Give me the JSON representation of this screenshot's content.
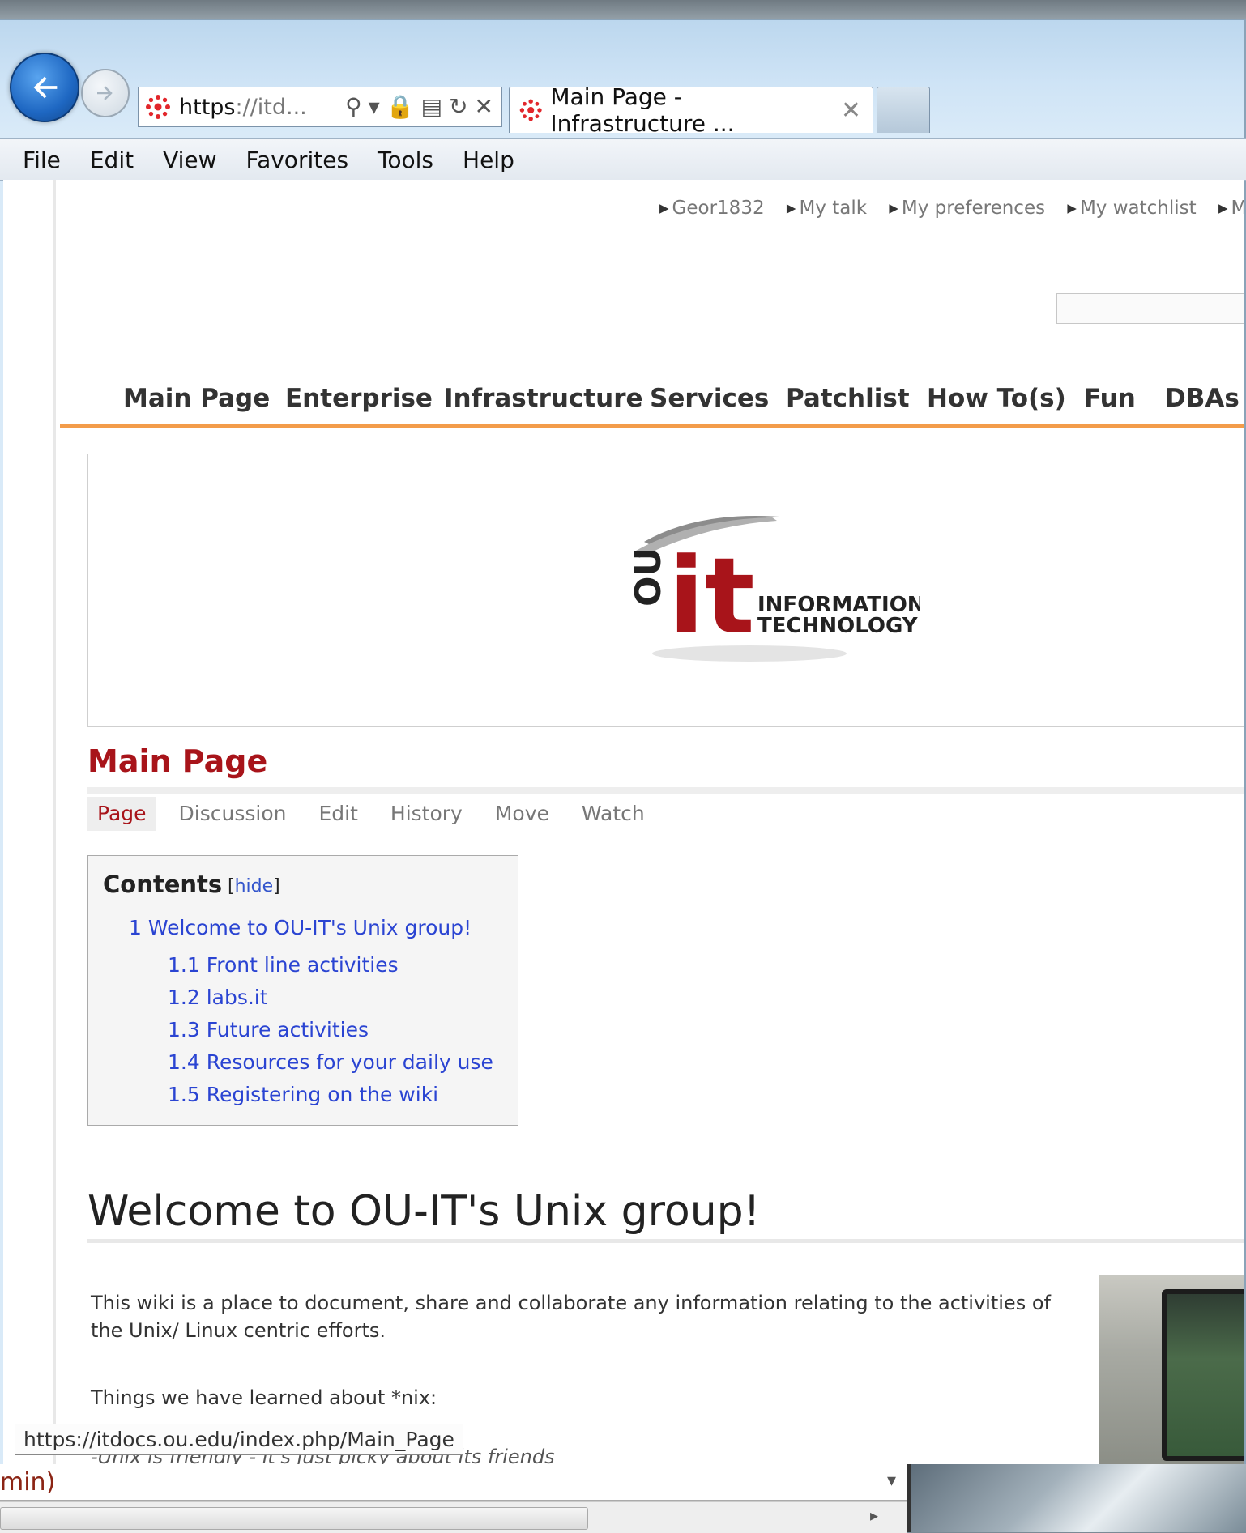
{
  "browser": {
    "address": {
      "protocol": "https",
      "rest": "://itd...",
      "tools": {
        "search": "⚲",
        "dropdown": "▾",
        "lock": "🔒",
        "compat": "▤",
        "refresh": "↻",
        "stop": "✕"
      }
    },
    "tabs": [
      {
        "title": "Main Page - Infrastructure ...",
        "close": "✕"
      }
    ],
    "menu": [
      "File",
      "Edit",
      "View",
      "Favorites",
      "Tools",
      "Help"
    ],
    "accent_color": "#1e67c2"
  },
  "wiki": {
    "user_links": [
      "Geor1832",
      "My talk",
      "My preferences",
      "My watchlist",
      "My c"
    ],
    "top_nav": [
      "Main Page",
      "Enterprise",
      "Infrastructure",
      "Services",
      "Patchlist",
      "How To(s)",
      "Fun",
      "DBAs"
    ],
    "logo": {
      "mark": "it",
      "line1": "INFORMATION",
      "line2": "TECHNOLOGY",
      "ou": "OU"
    },
    "page_title": "Main Page",
    "page_tabs": [
      "Page",
      "Discussion",
      "Edit",
      "History",
      "Move",
      "Watch"
    ],
    "toc": {
      "title": "Contents",
      "hide_open": "[",
      "hide_label": "hide",
      "hide_close": "]",
      "items": [
        "1 Welcome to OU-IT's Unix group!",
        "1.1 Front line activities",
        "1.2 labs.it",
        "1.3 Future activities",
        "1.4 Resources for your daily use",
        "1.5 Registering on the wiki"
      ]
    },
    "heading": "Welcome to OU-IT's Unix group!",
    "paragraph": "This wiki is a place to document, share and collaborate any information relating to the activities of the Unix/ Linux centric efforts.",
    "things_learned": "Things we have learned about *nix:",
    "quote_partial": "-Unix is friendly - it's just picky about its friends",
    "title_color": "#a8141a",
    "nav_accent_color": "#f39c4a",
    "link_color": "#2a44d2"
  },
  "status_url": "https://itdocs.ou.edu/index.php/Main_Page",
  "underlying_window": {
    "combo_text": "min)",
    "combo_arrow": "▾",
    "scroll_right": "▸"
  }
}
